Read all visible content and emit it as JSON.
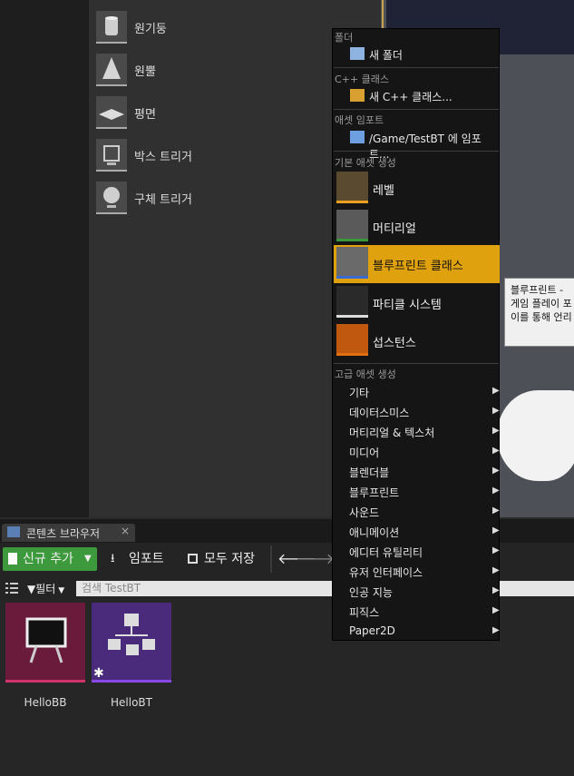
{
  "place_actors": {
    "items": [
      {
        "label": "원기둥",
        "icon": "cylinder-icon"
      },
      {
        "label": "원뿔",
        "icon": "cone-icon"
      },
      {
        "label": "평면",
        "icon": "plane-icon"
      },
      {
        "label": "박스 트리거",
        "icon": "box-trigger-icon"
      },
      {
        "label": "구체 트리거",
        "icon": "sphere-trigger-icon"
      }
    ]
  },
  "content_browser": {
    "tab_label": "콘텐츠 브라우저",
    "add_new_label": "신규 추가",
    "import_label": "임포트",
    "save_all_label": "모두 저장",
    "filter_label": "필터",
    "search_placeholder": "검색 TestBT",
    "assets": [
      {
        "name": "HelloBB",
        "color": "#6a1a3a",
        "icon": "blackboard-icon"
      },
      {
        "name": "HelloBT",
        "color": "#4a2a7a",
        "icon": "behavior-tree-icon"
      }
    ]
  },
  "context_menu": {
    "folder_header": "폴더",
    "new_folder": "새 폴더",
    "cpp_header": "C++ 클래스",
    "new_cpp": "새 C++ 클래스...",
    "import_header": "애셋 임포트",
    "import_to": "/Game/TestBT 에 임포트...",
    "basic_header": "기본 애셋 생성",
    "basic_items": [
      {
        "label": "레벨",
        "icon": "level-icon"
      },
      {
        "label": "머티리얼",
        "icon": "material-icon"
      },
      {
        "label": "블루프린트 클래스",
        "icon": "blueprint-icon",
        "highlighted": true
      },
      {
        "label": "파티클 시스템",
        "icon": "particle-icon"
      },
      {
        "label": "섭스턴스",
        "icon": "substance-icon"
      }
    ],
    "advanced_header": "고급 애셋 생성",
    "advanced_items": [
      "기타",
      "데이터스미스",
      "머티리얼 & 텍스처",
      "미디어",
      "블렌더블",
      "블루프린트",
      "사운드",
      "애니메이션",
      "에디터 유틸리티",
      "유저 인터페이스",
      "인공 지능",
      "피직스",
      "Paper2D"
    ],
    "highlight_color": "#e0a10e"
  },
  "tooltip": {
    "lines": [
      "블루프린트 -",
      "게임 플레이 포",
      "이를 통해 언리"
    ]
  }
}
